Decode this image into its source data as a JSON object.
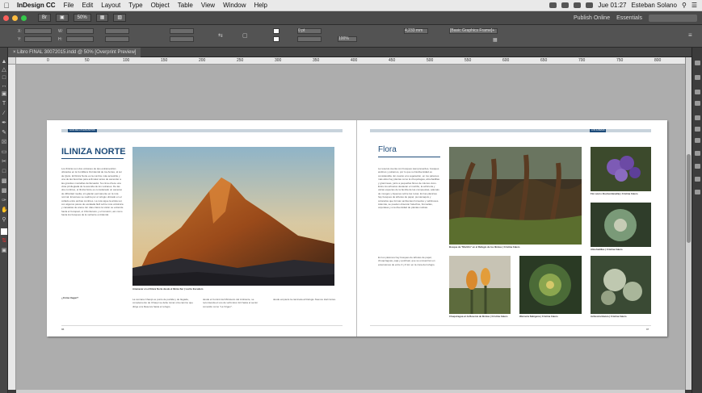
{
  "menubar": {
    "app_name": "InDesign CC",
    "items": [
      "File",
      "Edit",
      "Layout",
      "Type",
      "Object",
      "Table",
      "View",
      "Window",
      "Help"
    ],
    "clock": "Jue 01:27",
    "user": "Esteban Solano"
  },
  "appbar": {
    "zoom": "50%",
    "publish_label": "Publish Online",
    "workspace": "Essentials"
  },
  "control": {
    "stroke_value": "0 pt",
    "percent_value": "100%",
    "measure_value": "4,233 mm",
    "frame_style": "[Basic Graphics Frame]+"
  },
  "document": {
    "tab_label": "Libro FINAL 30072015.indd @ 50% [Overprint Preview]"
  },
  "ruler": {
    "ticks": [
      "0",
      "50",
      "100",
      "150",
      "200",
      "250",
      "300",
      "350",
      "400",
      "450",
      "500",
      "550",
      "600",
      "650",
      "700",
      "750",
      "800",
      "850"
    ]
  },
  "left_page": {
    "header_tag": "GUIA DE LOS ENCANTOS",
    "title": "ILINIZA NORTE",
    "photo_caption": "Amanecer en el Iliniza Norte desde el Iliniza Sur  |  Lucho Escudero",
    "subhead": "¿Cómo llegar?",
    "folio": "96"
  },
  "right_page": {
    "header_tag": "LOS ILINIZAS",
    "title": "Flora",
    "captions": [
      "Bosque de \"Mortiño\" en el Refugio de los Ilinizas  |  Cristina Calero",
      "Flor azul o lila (Gentianella) | Cristina Calero",
      "Almohadillas  |  Cristina Calero",
      "Chuquiragua en la Reserva de Ilinizas  |  Cristina Calero",
      "Werneria Nubigena | Cristina Calero",
      "Achicoria blanca | Cristina Calero"
    ],
    "folio": "97"
  },
  "colors": {
    "accent": "#1e4c7a",
    "header_bar": "#c8d3dc",
    "pasteboard": "#adadad"
  }
}
